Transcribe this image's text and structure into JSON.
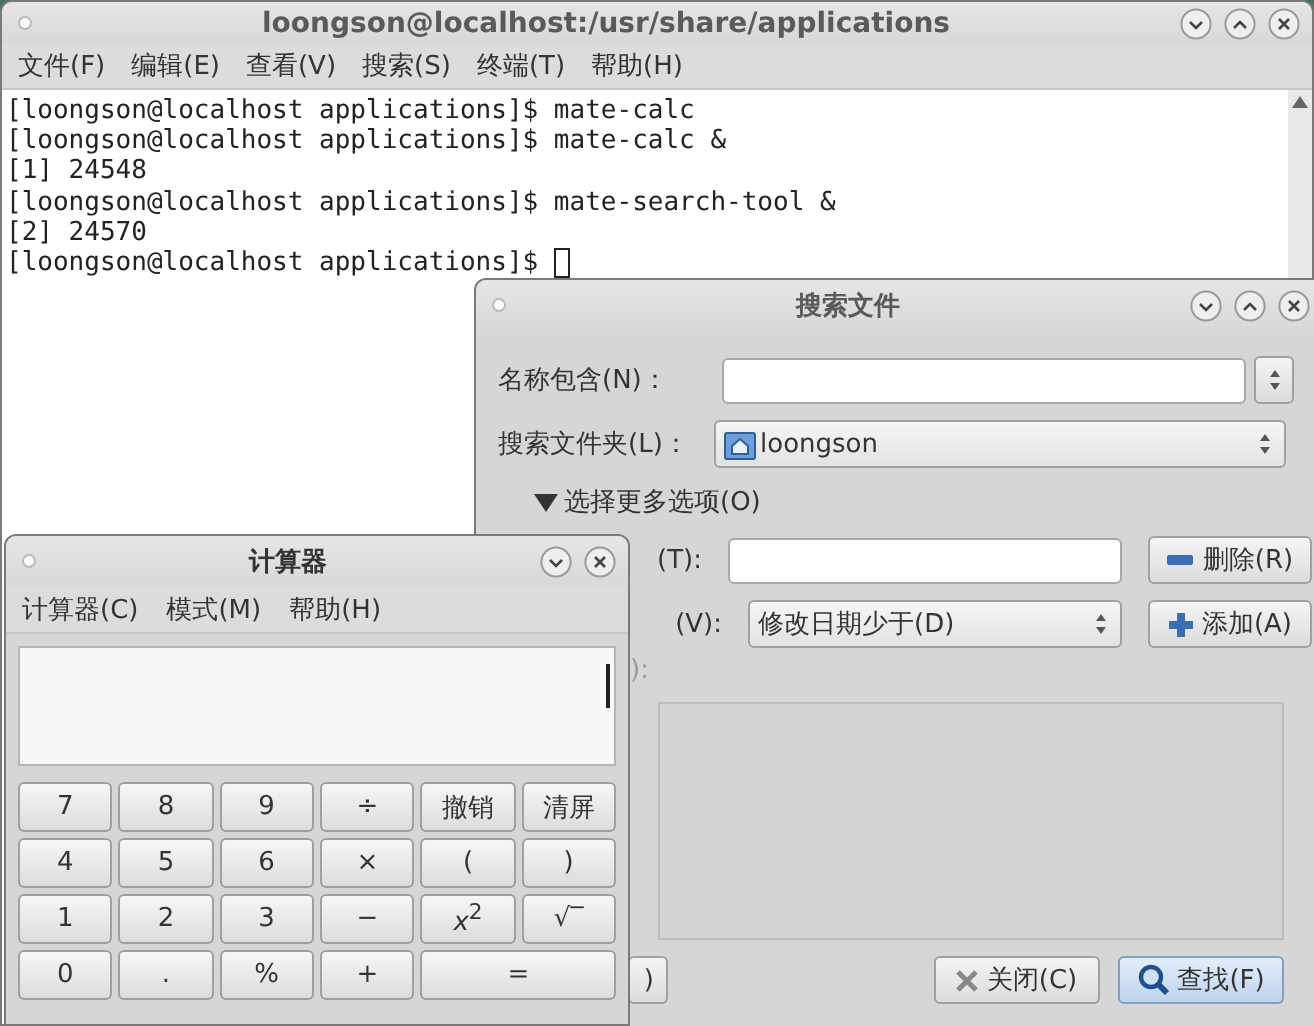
{
  "terminal": {
    "title": "loongson@localhost:/usr/share/applications",
    "menu": [
      "文件(F)",
      "编辑(E)",
      "查看(V)",
      "搜索(S)",
      "终端(T)",
      "帮助(H)"
    ],
    "lines": [
      "[loongson@localhost applications]$ mate-calc",
      "[loongson@localhost applications]$ mate-calc &",
      "[1] 24548",
      "[loongson@localhost applications]$ mate-search-tool &",
      "[2] 24570",
      "[loongson@localhost applications]$ "
    ]
  },
  "search_window": {
    "title": "搜索文件",
    "name_label": "名称包含(N)：",
    "folder_label": "搜索文件夹(L)：",
    "folder": "loongson",
    "expander": {
      "label": "选择更多选项(O)",
      "expanded": true
    },
    "options": [
      {
        "label": "(T):",
        "kind": "text",
        "button": "删除(R)"
      },
      {
        "label": "(V):",
        "kind": "combo",
        "value": "修改日期少于(D)",
        "button": "添加(A)"
      }
    ],
    "list_label": "):",
    "buttons": [
      {
        "label": ")",
        "kind": "partial"
      },
      {
        "label": "关闭(C)",
        "kind": "close"
      },
      {
        "label": "查找(F)",
        "kind": "find"
      }
    ]
  },
  "calculator": {
    "title": "计算器",
    "menu": [
      "计算器(C)",
      "模式(M)",
      "帮助(H)"
    ],
    "keys": [
      {
        "label": "7",
        "kind": "key"
      },
      {
        "label": "8",
        "kind": "key"
      },
      {
        "label": "9",
        "kind": "key"
      },
      {
        "label": "÷",
        "kind": "key"
      },
      {
        "label": "撤销",
        "kind": "key"
      },
      {
        "label": "清屏",
        "kind": "key"
      },
      {
        "label": "4",
        "kind": "key"
      },
      {
        "label": "5",
        "kind": "key"
      },
      {
        "label": "6",
        "kind": "key"
      },
      {
        "label": "×",
        "kind": "key"
      },
      {
        "label": "(",
        "kind": "key"
      },
      {
        "label": ")",
        "kind": "key"
      },
      {
        "label": "1",
        "kind": "key"
      },
      {
        "label": "2",
        "kind": "key"
      },
      {
        "label": "3",
        "kind": "key"
      },
      {
        "label": "−",
        "kind": "key"
      },
      {
        "label": "*x*$^{2}$",
        "kind": "key"
      },
      {
        "label": "√‾",
        "kind": "key"
      },
      {
        "label": "0",
        "kind": "key"
      },
      {
        "label": ".",
        "kind": "key"
      },
      {
        "label": "%",
        "kind": "key"
      },
      {
        "label": "+",
        "kind": "key"
      },
      {
        "label": "=",
        "kind": "wide"
      }
    ]
  }
}
